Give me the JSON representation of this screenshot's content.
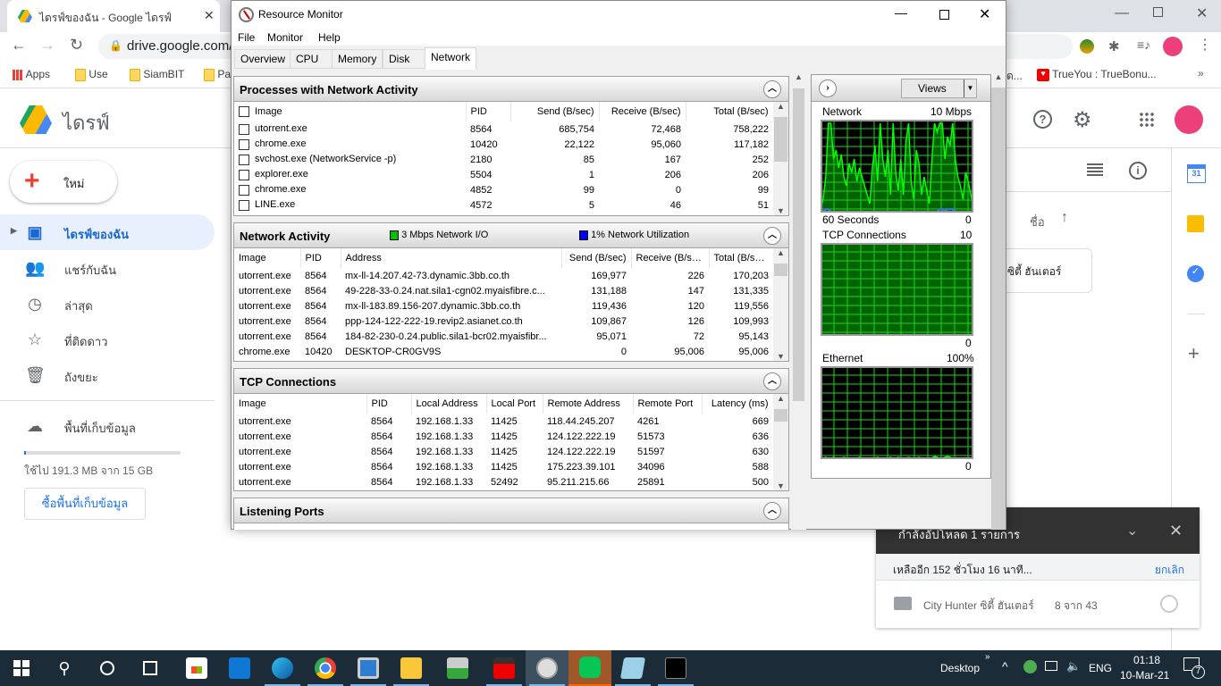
{
  "browser": {
    "tab_title": "ไดรฟ์ของฉัน - Google ไดรฟ์",
    "url": "drive.google.com/d",
    "bookmarks": [
      "Apps",
      "Use",
      "SiamBIT",
      "Pa",
      "ด...",
      "TrueYou : TrueBonu..."
    ]
  },
  "drive": {
    "logo_text": "ไดรฟ์",
    "new_label": "ใหม่",
    "nav": [
      {
        "label": "ไดรฟ์ของฉัน",
        "icon": "my-drive-icon"
      },
      {
        "label": "แชร์กับฉัน",
        "icon": "shared-icon"
      },
      {
        "label": "ล่าสุด",
        "icon": "clock-icon"
      },
      {
        "label": "ที่ติดดาว",
        "icon": "star-icon"
      },
      {
        "label": "ถังขยะ",
        "icon": "trash-icon"
      }
    ],
    "storage_label": "พื้นที่เก็บข้อมูล",
    "storage_used": "ใช้ไป 191.3 MB จาก 15 GB",
    "storage_fraction": 0.0125,
    "buy_storage": "ซื้อพื้นที่เก็บข้อมูล",
    "sort_label": "ชื่อ",
    "card_text": "ซิตี้ ฮันเตอร์",
    "calendar_day": "31"
  },
  "resmon": {
    "title": "Resource Monitor",
    "menu": [
      "File",
      "Monitor",
      "Help"
    ],
    "tabs": [
      "Overview",
      "CPU",
      "Memory",
      "Disk",
      "Network"
    ],
    "active_tab": "Network",
    "processes": {
      "title": "Processes with Network Activity",
      "columns": [
        "Image",
        "PID",
        "Send (B/sec)",
        "Receive (B/sec)",
        "Total (B/sec)"
      ],
      "rows": [
        [
          "utorrent.exe",
          "8564",
          "685,754",
          "72,468",
          "758,222"
        ],
        [
          "chrome.exe",
          "10420",
          "22,122",
          "95,060",
          "117,182"
        ],
        [
          "svchost.exe (NetworkService -p)",
          "2180",
          "85",
          "167",
          "252"
        ],
        [
          "explorer.exe",
          "5504",
          "1",
          "206",
          "206"
        ],
        [
          "chrome.exe",
          "4852",
          "99",
          "0",
          "99"
        ],
        [
          "LINE.exe",
          "4572",
          "5",
          "46",
          "51"
        ]
      ]
    },
    "activity": {
      "title": "Network Activity",
      "io": "3 Mbps Network I/O",
      "util": "1% Network Utilization",
      "io_color": "#00c000",
      "util_color": "#0000ff",
      "columns": [
        "Image",
        "PID",
        "Address",
        "Send (B/sec)",
        "Receive (B/sec)",
        "Total (B/sec)"
      ],
      "rows": [
        [
          "utorrent.exe",
          "8564",
          "mx-ll-14.207.42-73.dynamic.3bb.co.th",
          "169,977",
          "226",
          "170,203"
        ],
        [
          "utorrent.exe",
          "8564",
          "49-228-33-0.24.nat.sila1-cgn02.myaisfibre.c...",
          "131,188",
          "147",
          "131,335"
        ],
        [
          "utorrent.exe",
          "8564",
          "mx-ll-183.89.156-207.dynamic.3bb.co.th",
          "119,436",
          "120",
          "119,556"
        ],
        [
          "utorrent.exe",
          "8564",
          "ppp-124-122-222-19.revip2.asianet.co.th",
          "109,867",
          "126",
          "109,993"
        ],
        [
          "utorrent.exe",
          "8564",
          "184-82-230-0.24.public.sila1-bcr02.myaisfibr...",
          "95,071",
          "72",
          "95,143"
        ],
        [
          "chrome.exe",
          "10420",
          "DESKTOP-CR0GV9S",
          "0",
          "95,006",
          "95,006"
        ]
      ]
    },
    "tcp": {
      "title": "TCP Connections",
      "columns": [
        "Image",
        "PID",
        "Local Address",
        "Local Port",
        "Remote Address",
        "Remote Port",
        "Latency (ms)"
      ],
      "rows": [
        [
          "utorrent.exe",
          "8564",
          "192.168.1.33",
          "11425",
          "118.44.245.207",
          "4261",
          "669"
        ],
        [
          "utorrent.exe",
          "8564",
          "192.168.1.33",
          "11425",
          "124.122.222.19",
          "51573",
          "636"
        ],
        [
          "utorrent.exe",
          "8564",
          "192.168.1.33",
          "11425",
          "124.122.222.19",
          "51597",
          "630"
        ],
        [
          "utorrent.exe",
          "8564",
          "192.168.1.33",
          "11425",
          "175.223.39.101",
          "34096",
          "588"
        ],
        [
          "utorrent.exe",
          "8564",
          "192.168.1.33",
          "52492",
          "95.211.215.66",
          "25891",
          "500"
        ]
      ]
    },
    "listening": {
      "title": "Listening Ports"
    },
    "views_label": "Views",
    "graphs": [
      {
        "title": "Network",
        "max": "10 Mbps",
        "footer": "60 Seconds",
        "min": "0",
        "values": [
          5,
          15,
          40,
          100,
          100,
          60,
          70,
          50,
          65,
          40,
          30,
          55,
          45,
          60,
          35,
          50,
          40,
          30,
          20,
          10,
          50,
          75,
          35,
          100,
          60,
          40,
          70,
          20,
          100,
          45,
          25,
          60,
          20,
          80,
          100,
          35,
          15,
          70,
          55,
          20,
          40,
          25,
          10,
          60,
          100,
          90,
          100,
          100,
          60,
          85,
          75,
          100,
          60,
          40,
          30,
          15,
          45,
          35,
          20,
          10
        ],
        "blue": [
          0,
          0,
          3,
          3,
          0,
          0,
          0,
          0,
          0,
          0,
          0,
          0,
          0,
          0,
          0,
          0,
          0,
          0,
          0,
          0,
          0,
          0,
          0,
          0,
          0,
          0,
          0,
          0,
          0,
          0,
          0,
          0,
          0,
          0,
          0,
          0,
          0,
          0,
          0,
          0,
          0,
          0,
          0,
          0,
          0,
          0,
          3,
          3,
          0,
          3,
          3,
          3,
          0,
          0,
          0,
          0,
          0,
          0,
          0,
          0
        ]
      },
      {
        "title": "TCP Connections",
        "max": "10",
        "min": "0",
        "fill": 1.0
      },
      {
        "title": "Ethernet",
        "max": "100%",
        "min": "0",
        "values": [
          1,
          1,
          2,
          1,
          1,
          2,
          1,
          1,
          1,
          2,
          1,
          1,
          1,
          1,
          1,
          2,
          1,
          1,
          1,
          1,
          1,
          1,
          2,
          1,
          1,
          1,
          1,
          2,
          1,
          1,
          2,
          1,
          1,
          1,
          2,
          1,
          1,
          1,
          2,
          1,
          1,
          1,
          1,
          1,
          3,
          2,
          1,
          1,
          2,
          3,
          2,
          1,
          1,
          1,
          1,
          1,
          1,
          1,
          1,
          1
        ]
      }
    ]
  },
  "download": {
    "header": "กำลังอัปโหลด 1 รายการ",
    "remaining": "เหลืออีก 152 ชั่วโมง 16 นาที...",
    "cancel": "ยกเลิก",
    "item_name": "City Hunter ซิตี้ ฮันเตอร์",
    "item_progress": "8 จาก 43"
  },
  "taskbar": {
    "desktop": "Desktop",
    "lang": "ENG",
    "time": "01:18",
    "date": "10-Mar-21",
    "notif_count": "7",
    "overflow": "»"
  }
}
